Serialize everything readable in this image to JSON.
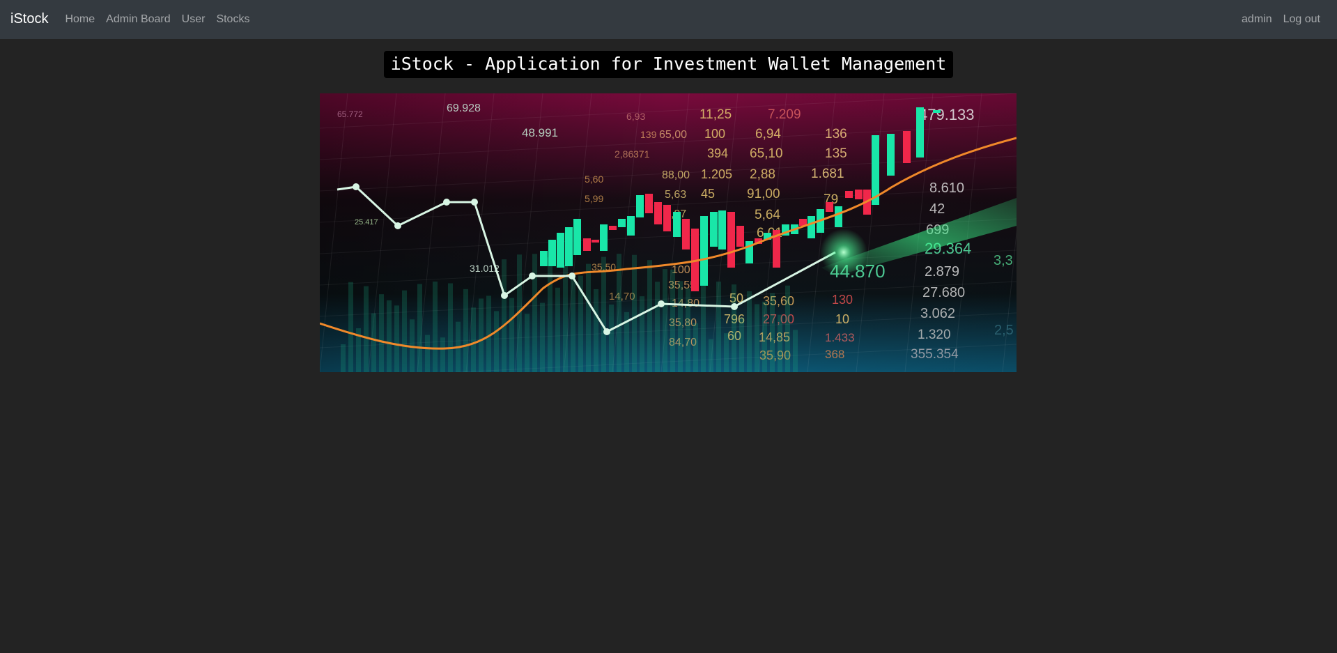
{
  "navbar": {
    "brand": "iStock",
    "links": [
      "Home",
      "Admin Board",
      "User",
      "Stocks"
    ],
    "right": {
      "username": "admin",
      "logout": "Log out"
    }
  },
  "main": {
    "title": "iStock - Application for Investment Wallet Management"
  },
  "hero_image": {
    "numbers": [
      "65.772",
      "69.928",
      "48.991",
      "25.417",
      "31.012",
      "479.133",
      "136",
      "135",
      "1.681",
      "8.610",
      "42",
      "699",
      "29.364",
      "44.870",
      "2.879",
      "27.680",
      "3.062",
      "1.320",
      "355.354",
      "7.209",
      "11,25",
      "6,94",
      "65,10",
      "2,88",
      "91,00",
      "5,64",
      "6,01",
      "79",
      "100",
      "394",
      "1.205",
      "45",
      "88,00",
      "5,63",
      "2,87",
      "65,00",
      "6,93",
      "139",
      "371",
      "2,86",
      "5,60",
      "5,99",
      "35,60",
      "27,00",
      "14,85",
      "35,90",
      "10",
      "130",
      "368",
      "50",
      "60",
      "796",
      "14,80",
      "35,80",
      "84,70",
      "35,55",
      "14,70",
      "35,50",
      "3,3",
      "2,5",
      "1.433",
      "100"
    ],
    "colors": {
      "top": "#7a0a3c",
      "middle": "#180c14",
      "bottom": "#0d5a78",
      "bull_candle": "#19e6a8",
      "bear_candle": "#f0274a",
      "trend_line": "#f0892a",
      "price_line": "#d8f5e4"
    }
  }
}
